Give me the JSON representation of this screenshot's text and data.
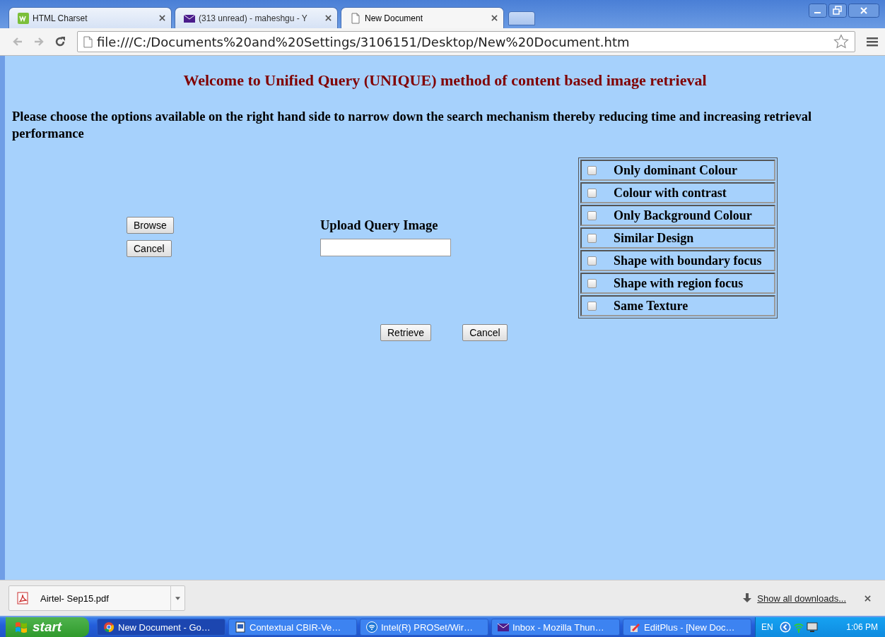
{
  "window": {
    "tabs": [
      {
        "label": "HTML Charset",
        "kind": "w3",
        "selected": false
      },
      {
        "label": "(313 unread) - maheshgu - Y",
        "kind": "mail",
        "selected": false
      },
      {
        "label": "New Document",
        "kind": "document",
        "selected": true
      }
    ]
  },
  "address_bar": {
    "url": "file:///C:/Documents%20and%20Settings/3106151/Desktop/New%20Document.htm"
  },
  "page": {
    "heading": "Welcome to Unified Query (UNIQUE) method of content based image retrieval",
    "intro": "Please choose the options available on the right hand side to narrow down the search mechanism thereby reducing time and increasing retrieval performance",
    "side_buttons": [
      "Browse",
      "Cancel"
    ],
    "upload": {
      "label": "Upload Query Image"
    },
    "options": [
      {
        "label": "Only dominant Colour",
        "checked": false
      },
      {
        "label": "Colour with contrast",
        "checked": false
      },
      {
        "label": "Only Background Colour",
        "checked": false
      },
      {
        "label": "Similar Design",
        "checked": false
      },
      {
        "label": "Shape with boundary focus",
        "checked": false
      },
      {
        "label": "Shape with region focus",
        "checked": false
      },
      {
        "label": "Same Texture",
        "checked": false
      }
    ],
    "buttons": [
      "Retrieve",
      "Cancel"
    ]
  },
  "download_bar": {
    "file": "Airtel- Sep15.pdf",
    "show_all": "Show all downloads..."
  },
  "taskbar": {
    "start": "start",
    "tasks": [
      {
        "label": "New Document - Go…",
        "kind": "chrome",
        "selected": true
      },
      {
        "label": "Contextual CBIR-Ve…",
        "kind": "word",
        "selected": false
      },
      {
        "label": "Intel(R) PROSet/Wir…",
        "kind": "wifi",
        "selected": false
      },
      {
        "label": "Inbox - Mozilla Thun…",
        "kind": "mail",
        "selected": false
      },
      {
        "label": "EditPlus - [New Doc…",
        "kind": "editplus",
        "selected": false
      }
    ],
    "language": "EN",
    "time": "1:06 PM"
  }
}
